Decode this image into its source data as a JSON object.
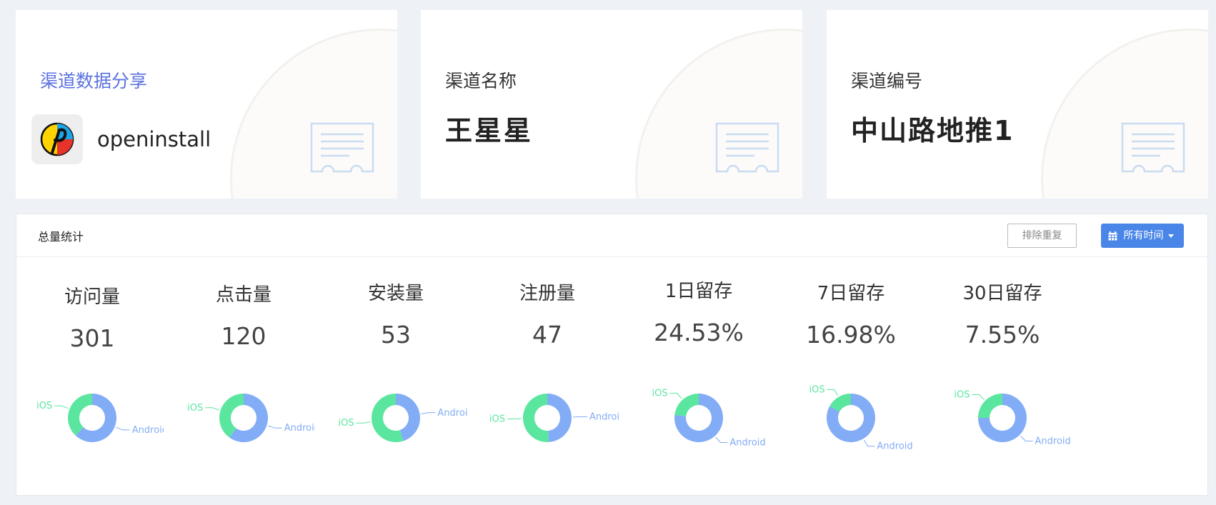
{
  "cards": [
    {
      "label": "渠道数据分享",
      "app_name": "openinstall"
    },
    {
      "label": "渠道名称",
      "value": "王星星"
    },
    {
      "label": "渠道编号",
      "value": "中山路地推1"
    }
  ],
  "stats": {
    "title": "总量统计",
    "dedupe_button": "排除重复",
    "time_button": "所有时间",
    "metrics": [
      {
        "label": "访问量",
        "value": "301",
        "ios_share": 0.38,
        "android_share": 0.62
      },
      {
        "label": "点击量",
        "value": "120",
        "ios_share": 0.4,
        "android_share": 0.6
      },
      {
        "label": "安装量",
        "value": "53",
        "ios_share": 0.55,
        "android_share": 0.45
      },
      {
        "label": "注册量",
        "value": "47",
        "ios_share": 0.51,
        "android_share": 0.49
      },
      {
        "label": "1日留存",
        "value": "24.53%",
        "ios_share": 0.23,
        "android_share": 0.77
      },
      {
        "label": "7日留存",
        "value": "16.98%",
        "ios_share": 0.17,
        "android_share": 0.83
      },
      {
        "label": "30日留存",
        "value": "7.55%",
        "ios_share": 0.25,
        "android_share": 0.75
      }
    ],
    "legend": {
      "ios": "iOS",
      "android": "Android"
    },
    "colors": {
      "ios": "#5be6a0",
      "android": "#82acf6",
      "accent": "#4a86e8",
      "link": "#5b72e0"
    }
  }
}
